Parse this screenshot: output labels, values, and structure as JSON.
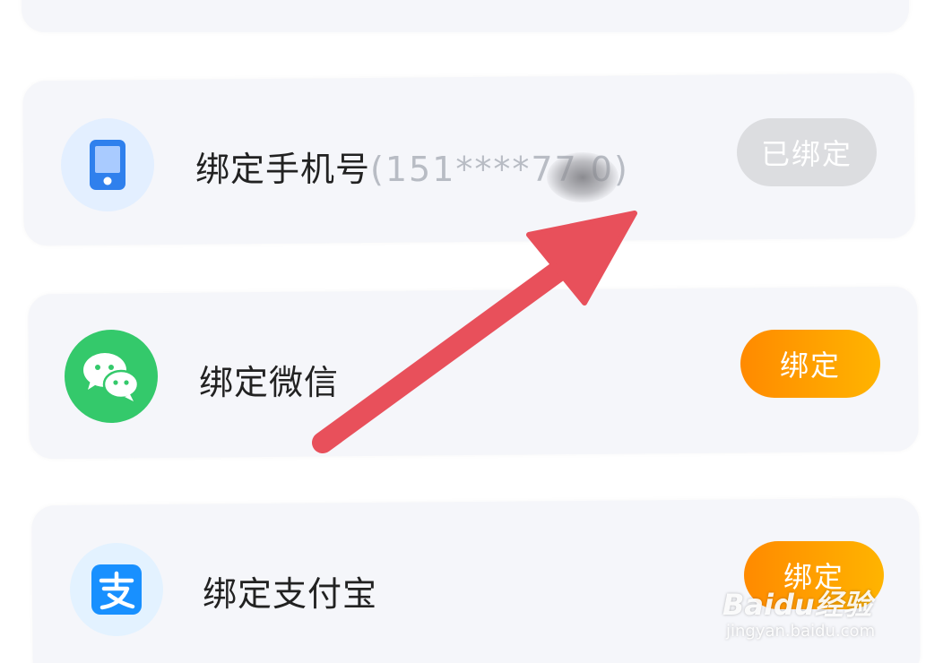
{
  "rows": [
    {
      "label": "绑定手机号",
      "phone_masked": "(151****77 0)",
      "button": "已绑定",
      "button_state": "bound",
      "icon": "mobile-phone-icon"
    },
    {
      "label": "绑定微信",
      "button": "绑定",
      "button_state": "unbound",
      "icon": "wechat-icon"
    },
    {
      "label": "绑定支付宝",
      "button": "绑定",
      "button_state": "unbound",
      "icon": "alipay-icon"
    }
  ],
  "annotation": {
    "icon": "red-arrow-icon",
    "color": "#e8505b"
  },
  "watermark": {
    "main": "Baidu经验",
    "sub": "jingyan.baidu.com"
  },
  "colors": {
    "card_bg": "#f5f6fa",
    "bound_button": "#dcdde0",
    "bind_button_start": "#ff8a00",
    "bind_button_end": "#ffb400",
    "wechat_green": "#34c96b",
    "alipay_blue": "#1890ff",
    "phone_blue": "#2f80ed"
  }
}
